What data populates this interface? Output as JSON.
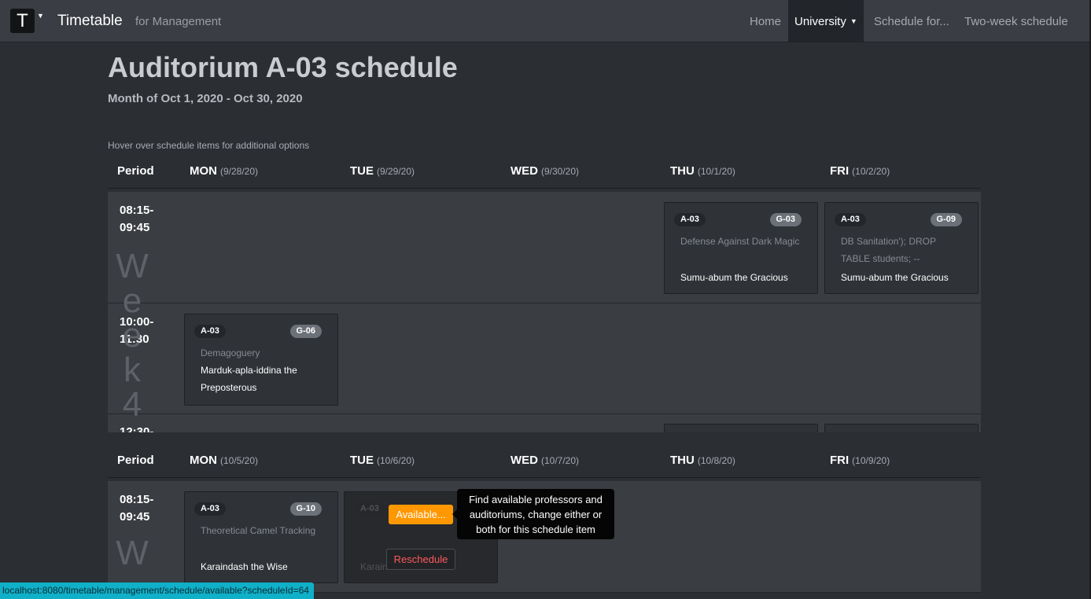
{
  "navbar": {
    "logo_letter": "T",
    "brand": "Timetable",
    "subtitle": "for Management",
    "links": [
      "Home",
      "University",
      "Schedule for...",
      "Two-week schedule"
    ]
  },
  "page": {
    "title": "Auditorium A-03 schedule",
    "subtitle": "Month of Oct 1, 2020 - Oct 30, 2020",
    "hint": "Hover over schedule items for additional options"
  },
  "weeks": [
    {
      "label": [
        "W",
        "e",
        "e",
        "k",
        "4"
      ],
      "columns": [
        {
          "day": "Period",
          "date": ""
        },
        {
          "day": "MON",
          "date": "(9/28/20)"
        },
        {
          "day": "TUE",
          "date": "(9/29/20)"
        },
        {
          "day": "WED",
          "date": "(9/30/20)"
        },
        {
          "day": "THU",
          "date": "(10/1/20)"
        },
        {
          "day": "FRI",
          "date": "(10/2/20)"
        }
      ],
      "periods": [
        {
          "start": "08:15-",
          "end": "09:45"
        },
        {
          "start": "10:00-",
          "end": "11:30"
        },
        {
          "start": "12:30-",
          "end": ""
        }
      ],
      "items": [
        {
          "day": "THU",
          "period": "08:15-09:45",
          "room": "A-03",
          "group": "G-03",
          "subject": "Defense Against Dark Magic",
          "professor": "Sumu-abum the Gracious"
        },
        {
          "day": "FRI",
          "period": "08:15-09:45",
          "room": "A-03",
          "group": "G-09",
          "subject": "DB Sanitation'); DROP TABLE students; --",
          "professor": "Sumu-abum the Gracious"
        },
        {
          "day": "MON",
          "period": "10:00-11:30",
          "room": "A-03",
          "group": "G-06",
          "subject": "Demagoguery",
          "professor": "Marduk-apla-iddina the Preposterous"
        }
      ]
    },
    {
      "label": [
        "W"
      ],
      "columns": [
        {
          "day": "Period",
          "date": ""
        },
        {
          "day": "MON",
          "date": "(10/5/20)"
        },
        {
          "day": "TUE",
          "date": "(10/6/20)"
        },
        {
          "day": "WED",
          "date": "(10/7/20)"
        },
        {
          "day": "THU",
          "date": "(10/8/20)"
        },
        {
          "day": "FRI",
          "date": "(10/9/20)"
        }
      ],
      "periods": [
        {
          "start": "08:15-",
          "end": "09:45"
        }
      ],
      "items": [
        {
          "day": "MON",
          "period": "08:15-09:45",
          "room": "A-03",
          "group": "G-10",
          "subject": "Theoretical Camel Tracking",
          "professor": "Karaindash the Wise"
        },
        {
          "day": "TUE",
          "period": "08:15-09:45",
          "room": "A-03",
          "group": "",
          "subject": "",
          "professor": "Karaindash the Wise",
          "hovered": true
        }
      ]
    }
  ],
  "hover_actions": {
    "available_label": "Available...",
    "reschedule_label": "Reschedule",
    "tooltip": "Find available professors and auditoriums, change either or both for this schedule item"
  },
  "status_url": "localhost:8080/timetable/management/schedule/available?scheduleId=64",
  "colors": {
    "navbar_bg": "#3a3d43",
    "page_bg": "#2b2e33",
    "available_button": "#ff9800",
    "reschedule_text": "#ff5a5a",
    "status_bar": "#0fb0c8"
  }
}
